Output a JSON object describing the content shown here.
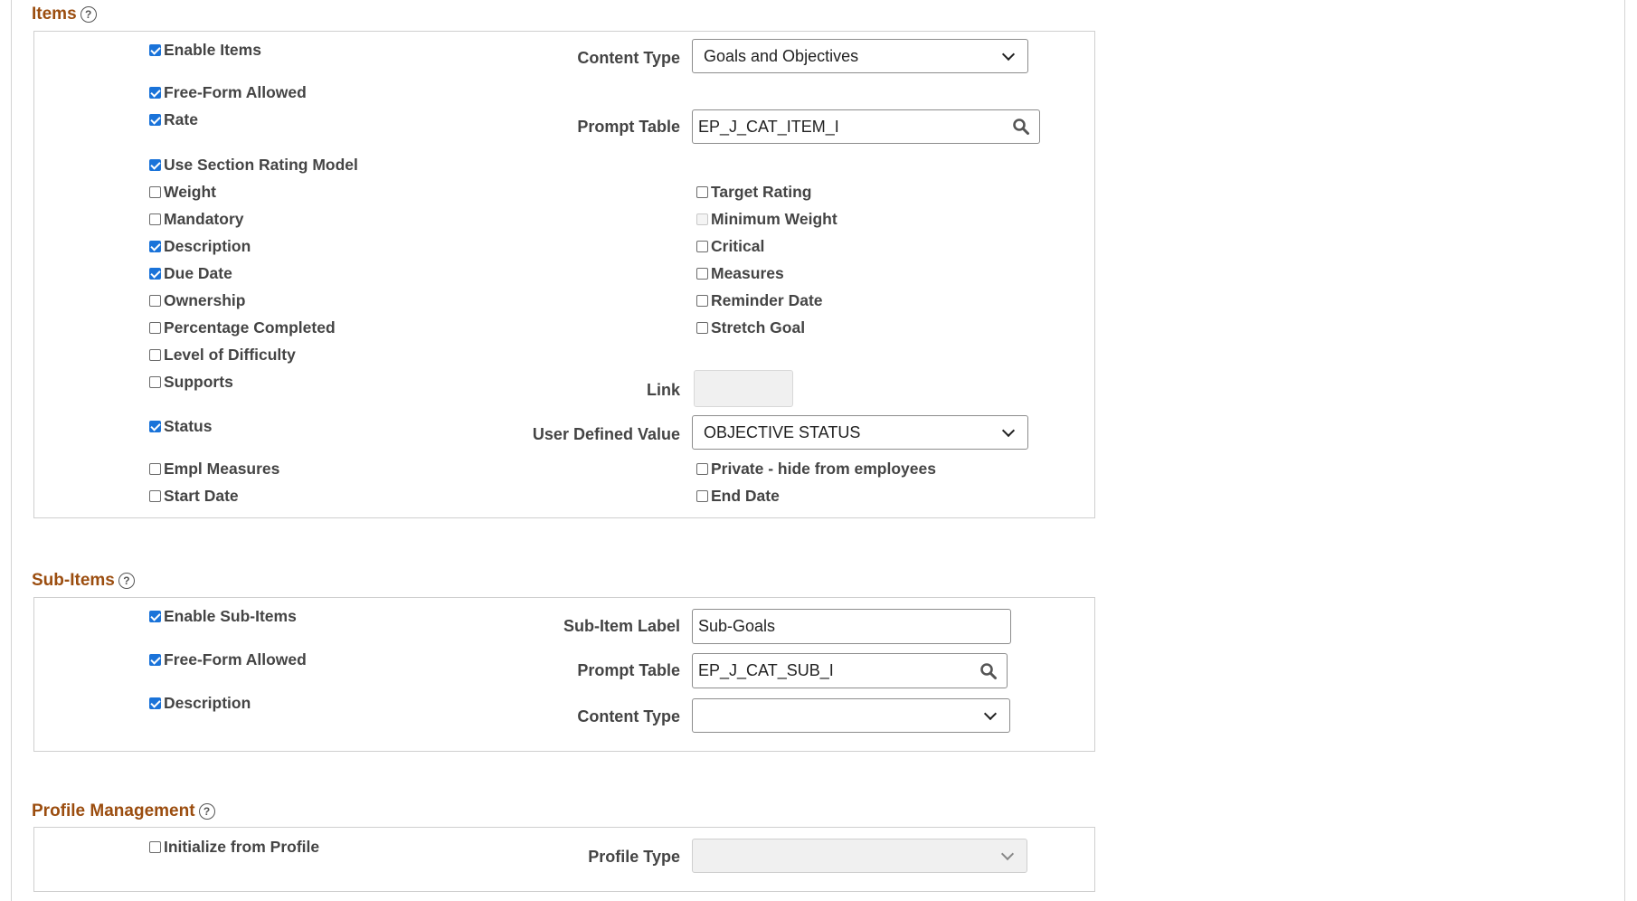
{
  "items": {
    "title": "Items",
    "help_icon": "question-circle-icon",
    "checks": {
      "enable_items": {
        "label": "Enable Items",
        "checked": true
      },
      "free_form": {
        "label": "Free-Form Allowed",
        "checked": true
      },
      "rate": {
        "label": "Rate",
        "checked": true
      },
      "use_section_rating": {
        "label": "Use Section Rating Model",
        "checked": true
      },
      "weight": {
        "label": "Weight",
        "checked": false
      },
      "mandatory": {
        "label": "Mandatory",
        "checked": false
      },
      "description": {
        "label": "Description",
        "checked": true
      },
      "due_date": {
        "label": "Due Date",
        "checked": true
      },
      "ownership": {
        "label": "Ownership",
        "checked": false
      },
      "percentage_completed": {
        "label": "Percentage Completed",
        "checked": false
      },
      "level_of_difficulty": {
        "label": "Level of Difficulty",
        "checked": false
      },
      "supports": {
        "label": "Supports",
        "checked": false
      },
      "status": {
        "label": "Status",
        "checked": true
      },
      "empl_measures": {
        "label": "Empl Measures",
        "checked": false
      },
      "start_date": {
        "label": "Start Date",
        "checked": false
      },
      "target_rating": {
        "label": "Target Rating",
        "checked": false
      },
      "minimum_weight": {
        "label": "Minimum Weight",
        "checked": false,
        "disabled": true
      },
      "critical": {
        "label": "Critical",
        "checked": false
      },
      "measures": {
        "label": "Measures",
        "checked": false
      },
      "reminder_date": {
        "label": "Reminder Date",
        "checked": false
      },
      "stretch_goal": {
        "label": "Stretch Goal",
        "checked": false
      },
      "private_hide": {
        "label": "Private - hide from employees",
        "checked": false
      },
      "end_date": {
        "label": "End Date",
        "checked": false
      }
    },
    "content_type_label": "Content Type",
    "content_type_value": "Goals and Objectives",
    "prompt_table_label": "Prompt Table",
    "prompt_table_value": "EP_J_CAT_ITEM_I",
    "link_label": "Link",
    "link_value": "",
    "user_defined_label": "User Defined Value",
    "user_defined_value": "OBJECTIVE STATUS"
  },
  "sub_items": {
    "title": "Sub-Items",
    "checks": {
      "enable_sub_items": {
        "label": "Enable Sub-Items",
        "checked": true
      },
      "free_form": {
        "label": "Free-Form Allowed",
        "checked": true
      },
      "description": {
        "label": "Description",
        "checked": true
      }
    },
    "sub_item_label_label": "Sub-Item Label",
    "sub_item_label_value": "Sub-Goals",
    "prompt_table_label": "Prompt Table",
    "prompt_table_value": "EP_J_CAT_SUB_I",
    "content_type_label": "Content Type",
    "content_type_value": ""
  },
  "profile": {
    "title": "Profile Management",
    "checks": {
      "initialize_from_profile": {
        "label": "Initialize from Profile",
        "checked": false
      }
    },
    "profile_type_label": "Profile Type",
    "profile_type_value": ""
  },
  "icons": {
    "search": "search-icon",
    "dropdown": "chevron-down-icon"
  },
  "colors": {
    "section_title": "#9b4d0f",
    "checkbox_checked": "#1a73d9"
  }
}
